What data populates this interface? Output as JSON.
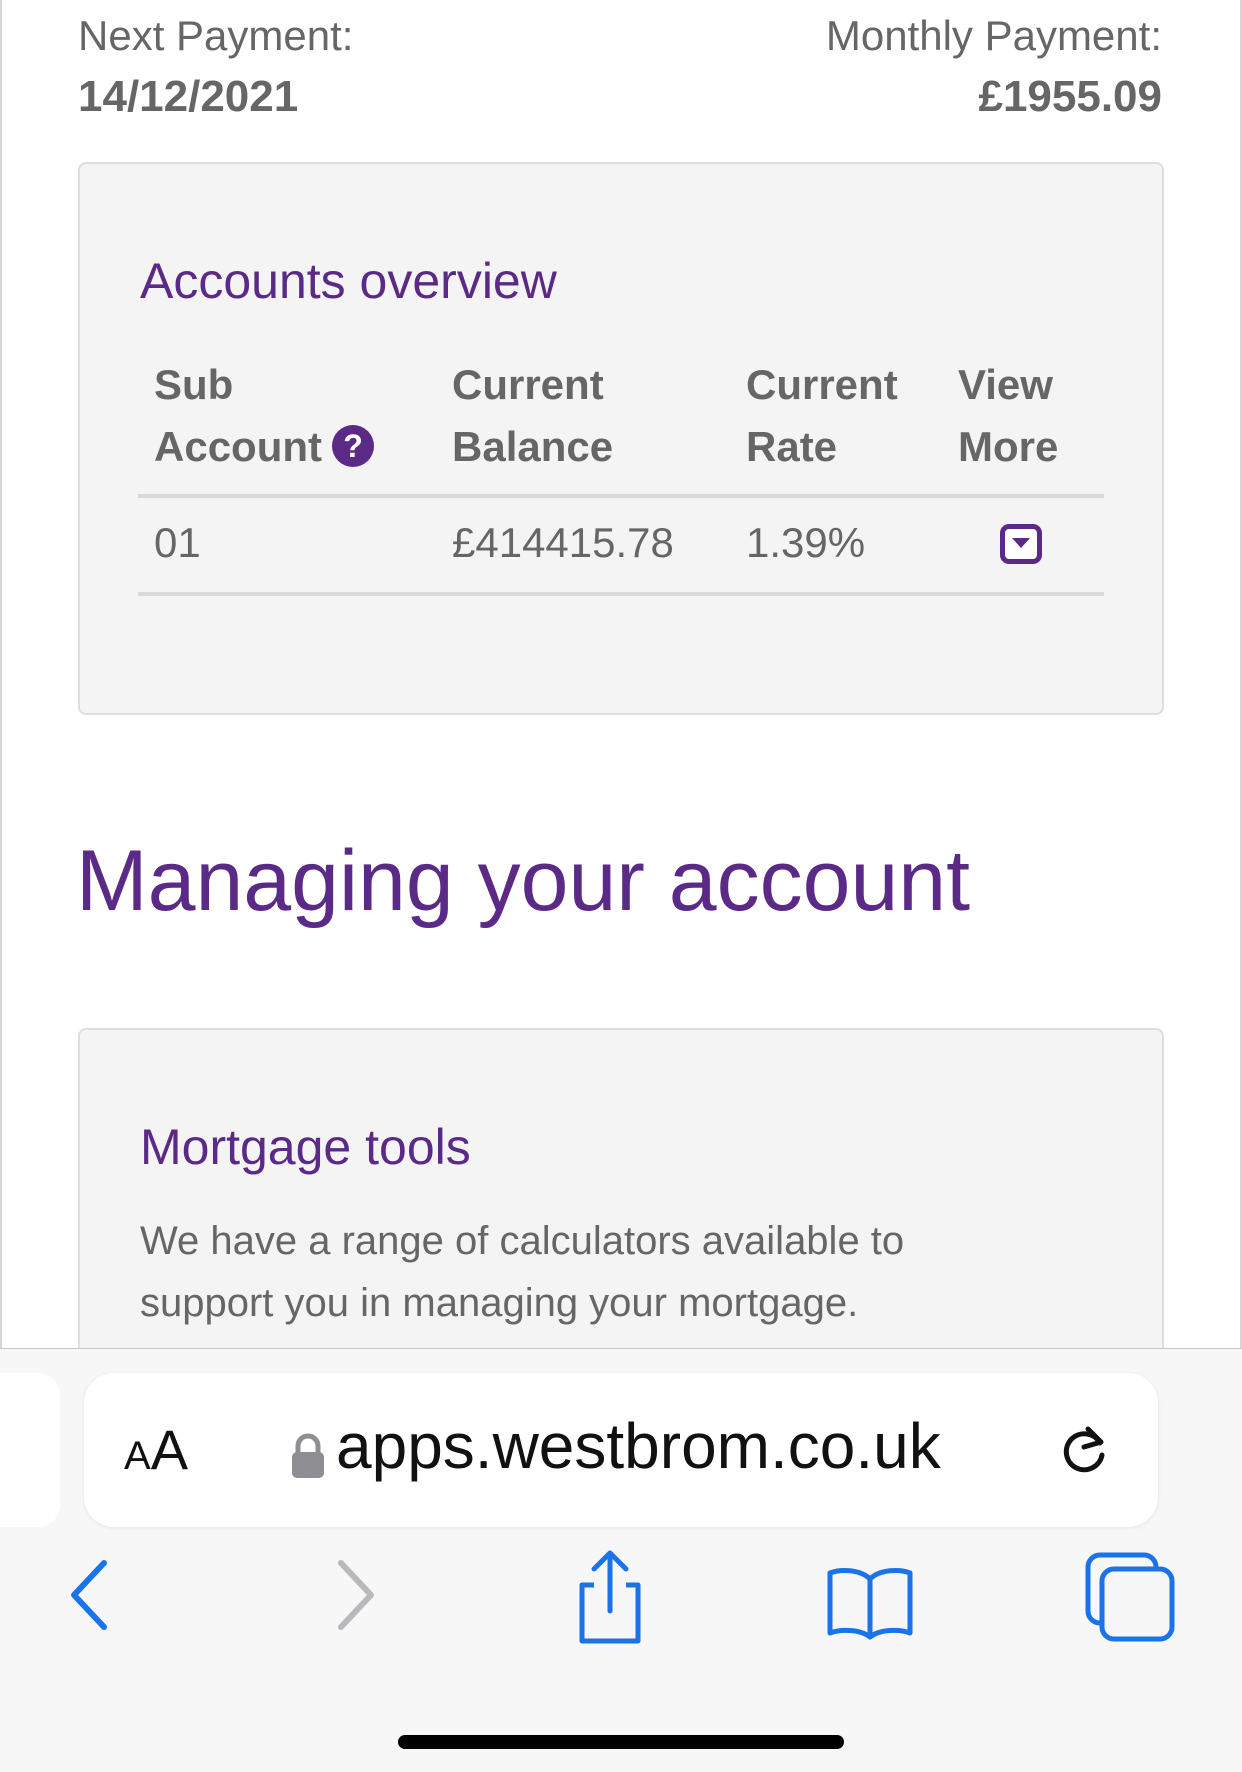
{
  "payment": {
    "next_label": "Next Payment:",
    "next_value": "14/12/2021",
    "monthly_label": "Monthly Payment:",
    "monthly_value": "£1955.09"
  },
  "accounts": {
    "title": "Accounts overview",
    "headers": {
      "sub_account_line1": "Sub",
      "sub_account_line2": "Account",
      "balance_line1": "Current",
      "balance_line2": "Balance",
      "rate_line1": "Current",
      "rate_line2": "Rate",
      "view_line1": "View",
      "view_line2": "More"
    },
    "rows": [
      {
        "sub_account": "01",
        "balance": "£414415.78",
        "rate": "1.39%"
      }
    ]
  },
  "section_heading": "Managing your account",
  "mortgage_tools": {
    "title": "Mortgage tools",
    "description": "We have a range of calculators available to support you in managing your mortgage."
  },
  "browser": {
    "aa_small": "A",
    "aa_large": "A",
    "url": "apps.westbrom.co.uk"
  },
  "colors": {
    "brand_purple": "#5b2a86",
    "ios_blue": "#1a73e8"
  }
}
